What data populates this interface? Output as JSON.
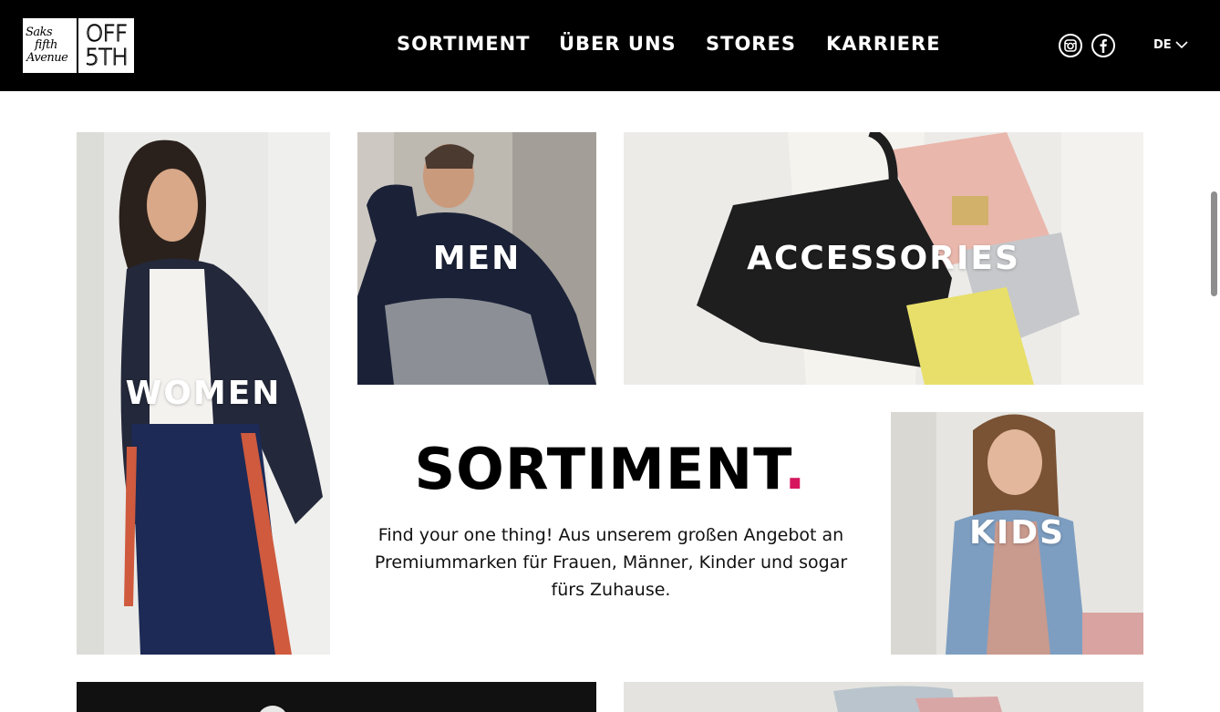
{
  "header": {
    "logo": {
      "line1": "Saks",
      "line2": "fifth",
      "line3": "Avenue",
      "off": "OFF",
      "fifth": "5TH"
    },
    "nav": [
      {
        "label": "SORTIMENT"
      },
      {
        "label": "ÜBER UNS"
      },
      {
        "label": "STORES"
      },
      {
        "label": "KARRIERE"
      }
    ],
    "social": [
      "instagram-icon",
      "facebook-icon"
    ],
    "language": "DE"
  },
  "tiles": {
    "women": "WOMEN",
    "men": "MEN",
    "accessories": "ACCESSORIES",
    "kids": "KIDS"
  },
  "content": {
    "title": "SORTIMENT",
    "title_dot": ".",
    "description": "Find your one thing! Aus unserem großen Angebot an Premiummarken für Frauen, Männer, Kinder und sogar fürs Zuhause."
  },
  "colors": {
    "header_bg": "#000000",
    "accent_dot": "#d6175e"
  }
}
